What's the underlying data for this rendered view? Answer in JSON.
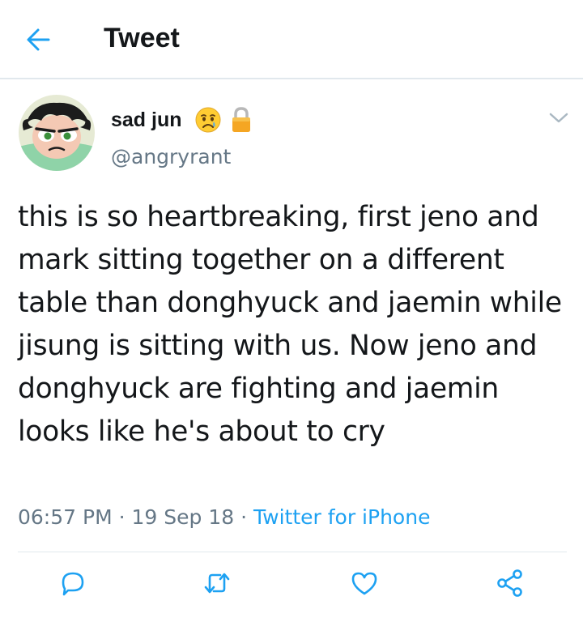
{
  "header": {
    "title": "Tweet",
    "back_icon": "arrow-left-icon"
  },
  "tweet": {
    "author": {
      "display_name": "sad jun",
      "emoji_icon": "crying-face-emoji-icon",
      "protected_icon": "lock-icon",
      "handle": "@angryrant"
    },
    "text": "this is so heartbreaking, first jeno and mark sitting together on a different table than donghyuck and jaemin while jisung is sitting with us. Now jeno and donghyuck are fighting and jaemin looks like he's about to cry",
    "time": "06:57 PM",
    "separator": "·",
    "date": "19 Sep 18",
    "source": "Twitter for iPhone"
  },
  "actions": [
    "reply-icon",
    "retweet-icon",
    "like-icon",
    "share-icon"
  ],
  "colors": {
    "accent": "#1da1f2",
    "text": "#14171a",
    "muted": "#657786",
    "divider": "#e1e8ed"
  }
}
